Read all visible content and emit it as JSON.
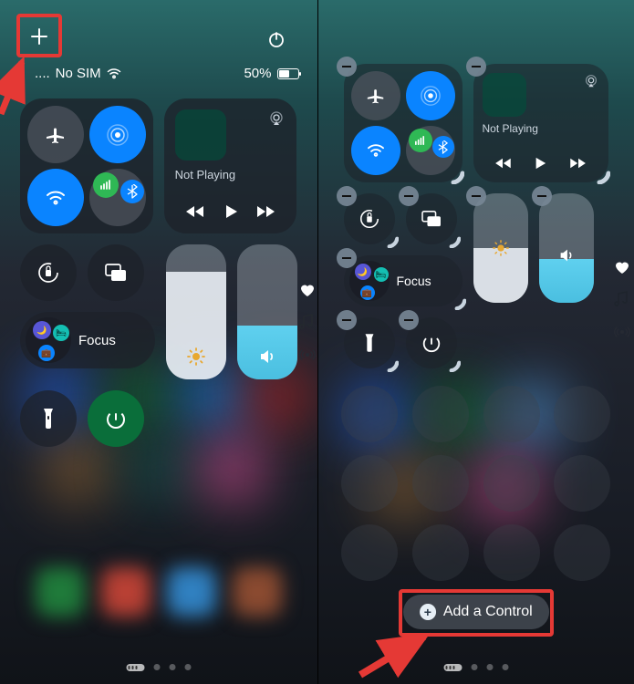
{
  "status": {
    "carrier": "No SIM",
    "signal_dots": "....",
    "battery": "50%"
  },
  "media": {
    "status": "Not Playing",
    "status_r": "Not Playing"
  },
  "focus": {
    "label": "Focus",
    "label_r": "Focus"
  },
  "add_control_label": "Add a Control"
}
